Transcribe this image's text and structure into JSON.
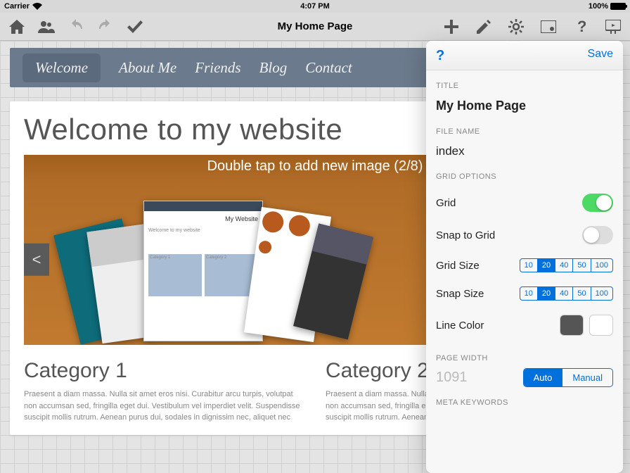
{
  "status": {
    "carrier": "Carrier",
    "time": "4:07 PM",
    "battery": "100%"
  },
  "toolbar": {
    "title": "My Home Page"
  },
  "nav": {
    "items": [
      {
        "label": "Welcome",
        "active": true
      },
      {
        "label": "About Me"
      },
      {
        "label": "Friends"
      },
      {
        "label": "Blog"
      },
      {
        "label": "Contact"
      }
    ]
  },
  "page": {
    "heading": "Welcome to my website",
    "slider_hint": "Double tap to add new image (2/8)",
    "prev": "<",
    "next": ">",
    "tmpl_title": "My Website",
    "tmpl_sub": "Welcome to my website",
    "tmpl_c1": "Category 1",
    "tmpl_c2": "Category 2",
    "categories": [
      {
        "title": "Category 1",
        "text": "Praesent a diam massa. Nulla sit amet eros nisi. Curabitur arcu turpis, volutpat non accumsan sed, fringilla eget dui. Vestibulum vel imperdiet velit. Suspendisse suscipit mollis rutrum. Aenean purus dui, sodales in dignissim nec, aliquet nec"
      },
      {
        "title": "Category 2",
        "text": "Praesent a diam massa. Nulla sit amet eros nisi. Curabitur arcu turpis, volutpat non accumsan sed, fringilla eget dui. Vestibulum vel imperdiet velit. Suspendisse suscipit mollis rutrum. Aenean purus dui, sodales in dignissim nec, aliquet nec"
      }
    ]
  },
  "panel": {
    "help": "?",
    "save": "Save",
    "title_label": "TITLE",
    "title_value": "My Home Page",
    "filename_label": "FILE NAME",
    "filename_value": "index",
    "grid_options_label": "GRID OPTIONS",
    "grid_label": "Grid",
    "snap_label": "Snap to Grid",
    "grid_size_label": "Grid Size",
    "snap_size_label": "Snap Size",
    "line_color_label": "Line Color",
    "size_options": [
      "10",
      "20",
      "40",
      "50",
      "100"
    ],
    "grid_size_selected": "20",
    "snap_size_selected": "20",
    "page_width_label": "PAGE WIDTH",
    "page_width_value": "1091",
    "pw_auto": "Auto",
    "pw_manual": "Manual",
    "meta_keywords_label": "META KEYWORDS"
  }
}
